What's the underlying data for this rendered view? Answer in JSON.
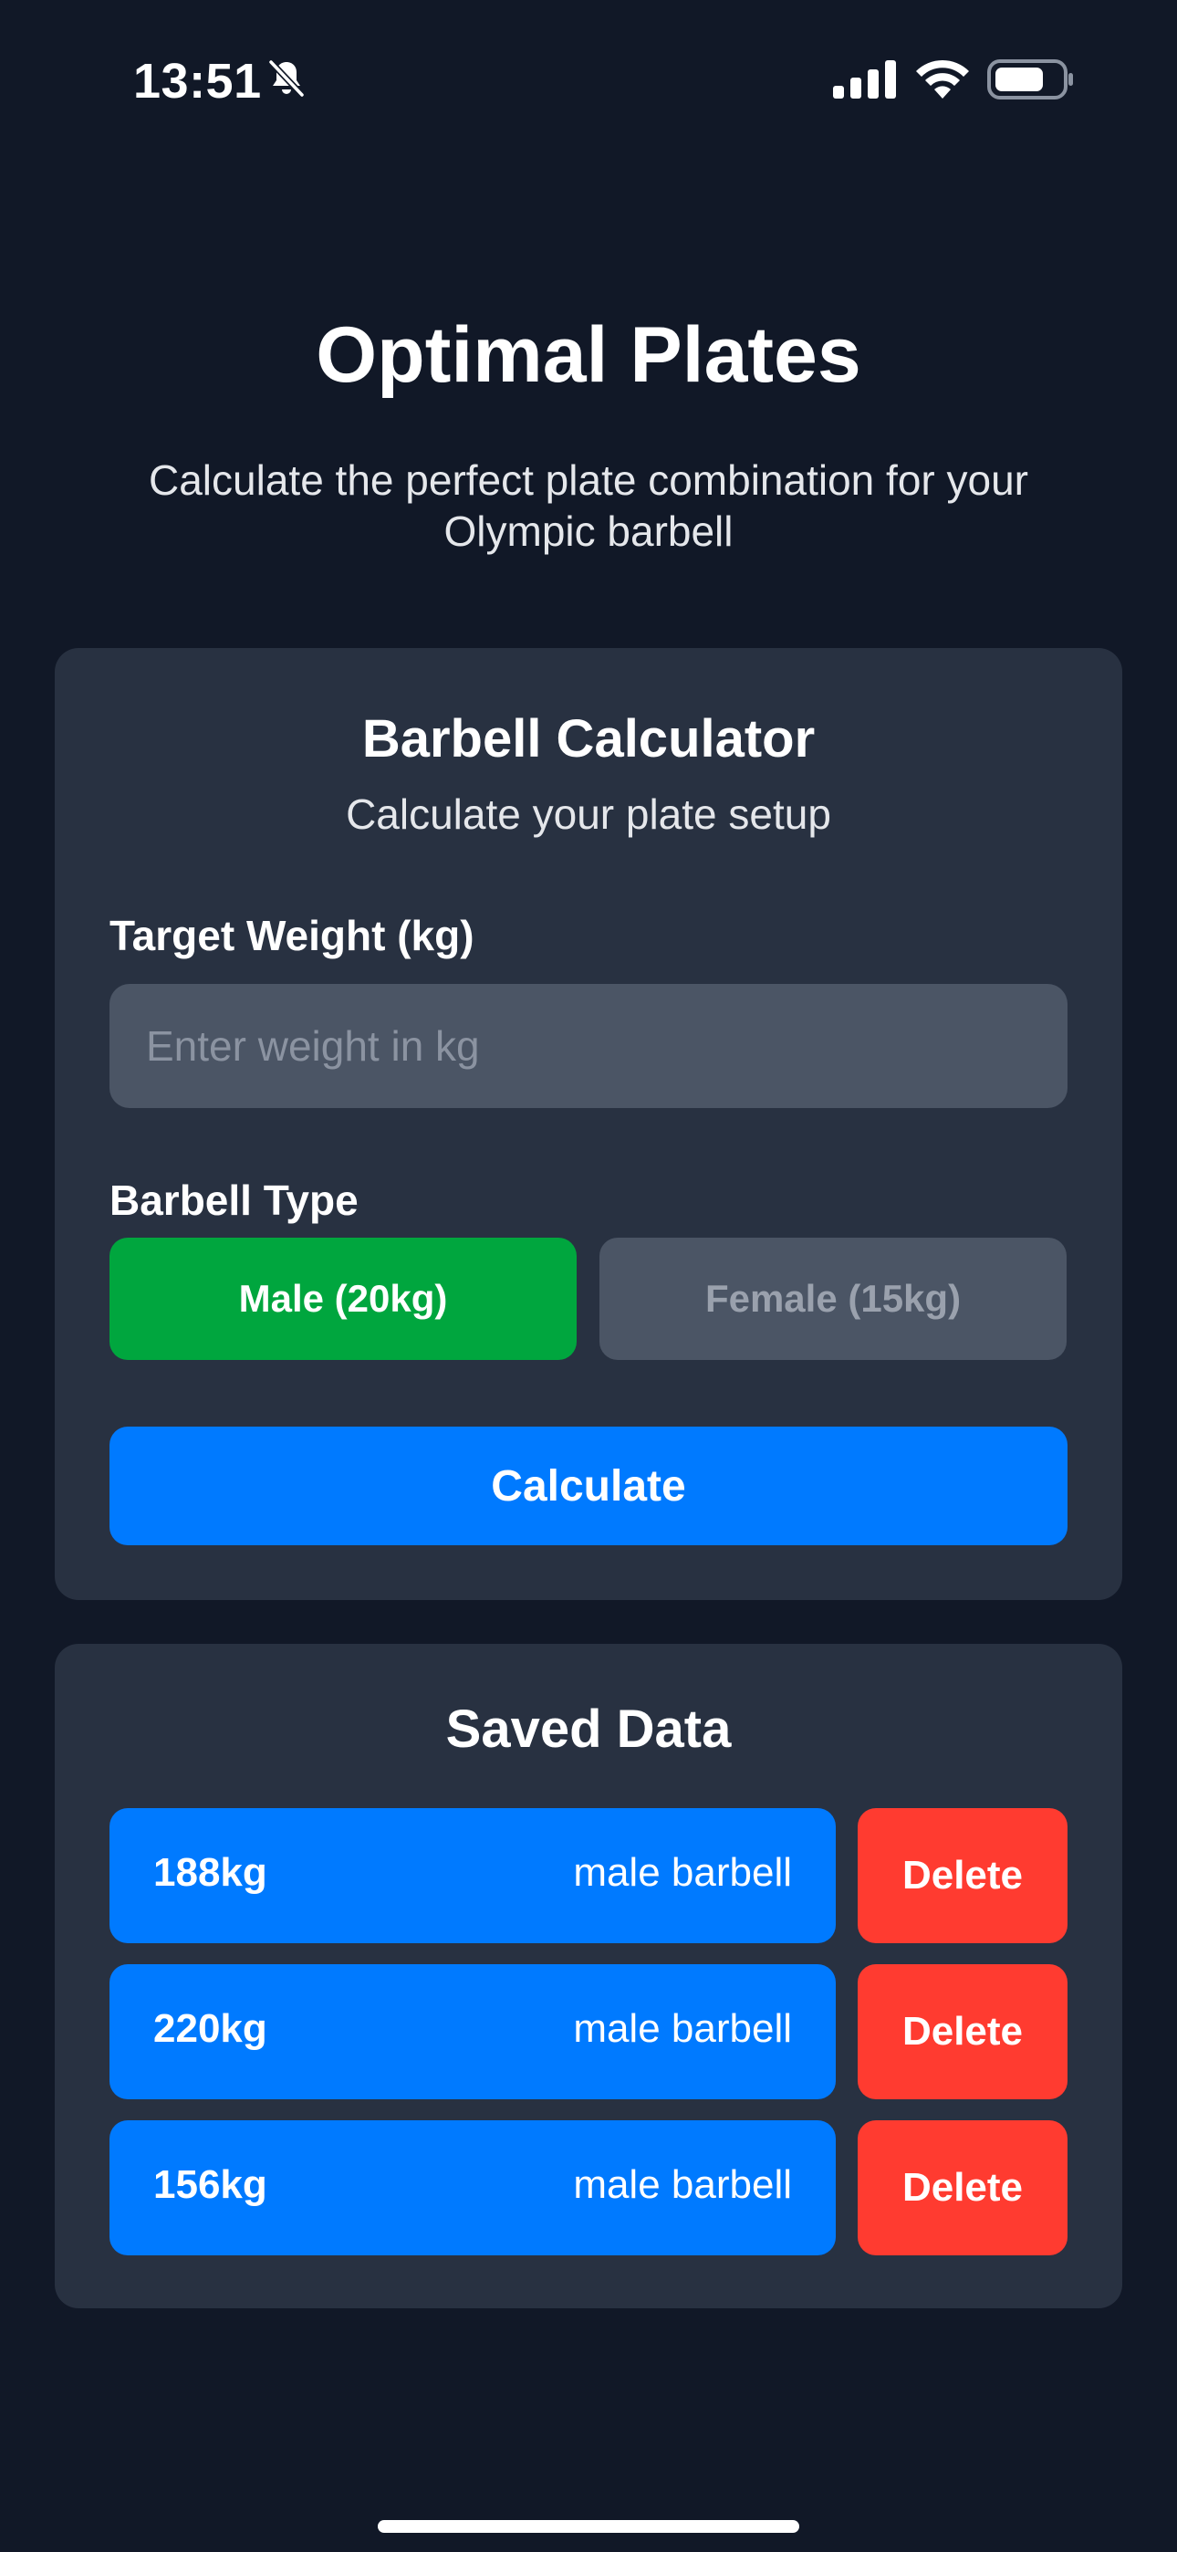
{
  "status_bar": {
    "time": "13:51",
    "icons": [
      "bell-slash-icon",
      "cellular-signal-icon",
      "wifi-icon",
      "battery-icon"
    ]
  },
  "header": {
    "title": "Optimal Plates",
    "subtitle": "Calculate the perfect plate combination for your Olympic barbell"
  },
  "calculator": {
    "title": "Barbell Calculator",
    "subtitle": "Calculate your plate setup",
    "weight_label": "Target Weight (kg)",
    "weight_value": "",
    "weight_placeholder": "Enter weight in kg",
    "barbell_label": "Barbell Type",
    "barbell_options": [
      {
        "label": "Male (20kg)",
        "selected": true
      },
      {
        "label": "Female (15kg)",
        "selected": false
      }
    ],
    "calculate_label": "Calculate"
  },
  "saved": {
    "title": "Saved Data",
    "items": [
      {
        "weight": "188kg",
        "type": "male barbell",
        "delete_label": "Delete"
      },
      {
        "weight": "220kg",
        "type": "male barbell",
        "delete_label": "Delete"
      },
      {
        "weight": "156kg",
        "type": "male barbell",
        "delete_label": "Delete"
      }
    ]
  },
  "colors": {
    "background": "#111827",
    "card": "#283141",
    "input": "#4b5565",
    "selected_green": "#00a63e",
    "primary_blue": "#007aff",
    "delete_red": "#ff3b30"
  }
}
